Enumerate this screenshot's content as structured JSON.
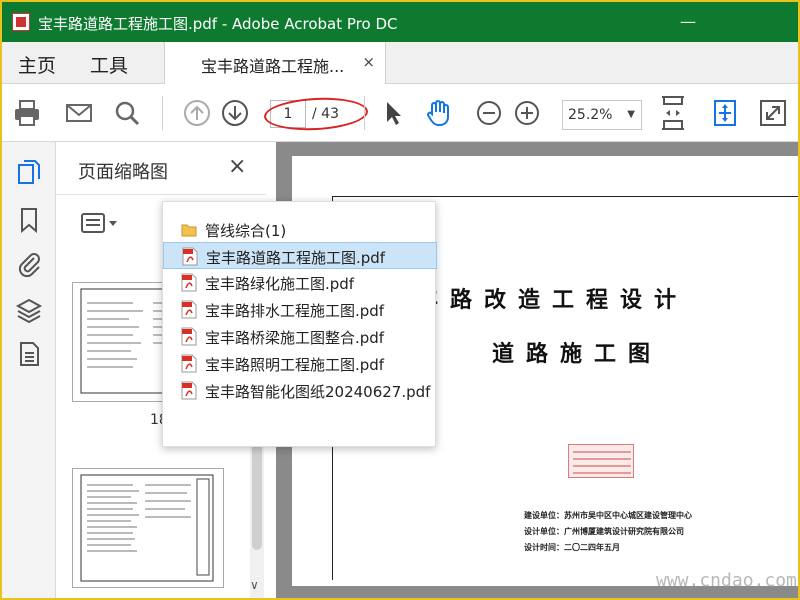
{
  "window": {
    "title": "宝丰路道路工程施工图.pdf - Adobe Acrobat Pro DC"
  },
  "menubar": {
    "home_label": "主页",
    "tools_label": "工具",
    "doc_tab_label": "宝丰路道路工程施...",
    "tab_close": "×"
  },
  "toolbar": {
    "icons": [
      "print-icon",
      "email-icon",
      "search-icon",
      "page-up-icon",
      "page-down-icon",
      "select-cursor-icon",
      "hand-tool-icon",
      "zoom-out-icon",
      "zoom-in-icon",
      "fit-page-icon",
      "fit-width-icon",
      "fullscreen-icon"
    ],
    "page_current": "1",
    "page_total": "/ 43",
    "zoom_value": "25.2%",
    "annotation_color": "#d82424"
  },
  "leftrail": {
    "icons": [
      "page-thumbnails-icon",
      "bookmark-icon",
      "attachment-icon",
      "layers-icon",
      "document-icon"
    ]
  },
  "thumbpanel": {
    "title": "页面缩略图",
    "close": "×",
    "thumb_label": "18"
  },
  "dropdown": {
    "items": [
      {
        "label": "管线综合(1)",
        "icon": "folder-icon"
      },
      {
        "label": "宝丰路道路工程施工图.pdf",
        "icon": "pdf-icon",
        "selected": true
      },
      {
        "label": "宝丰路绿化施工图.pdf",
        "icon": "pdf-icon"
      },
      {
        "label": "宝丰路排水工程施工图.pdf",
        "icon": "pdf-icon"
      },
      {
        "label": "宝丰路桥梁施工图整合.pdf",
        "icon": "pdf-icon"
      },
      {
        "label": "宝丰路照明工程施工图.pdf",
        "icon": "pdf-icon"
      },
      {
        "label": "宝丰路智能化图纸20240627.pdf",
        "icon": "pdf-icon"
      }
    ]
  },
  "document": {
    "title": "宝丰路改造工程设计",
    "subtitle": "道路施工图",
    "build_unit": "建设单位：苏州市吴中区中心城区建设管理中心",
    "design_unit": "设计单位：广州博厦建筑设计研究院有限公司",
    "design_time": "设计时间：二〇二四年五月",
    "watermark": "www.cndao.com"
  },
  "colors": {
    "titlebar": "#0e7a2f",
    "accent_blue": "#1473e6",
    "frame": "#e9c21b"
  }
}
